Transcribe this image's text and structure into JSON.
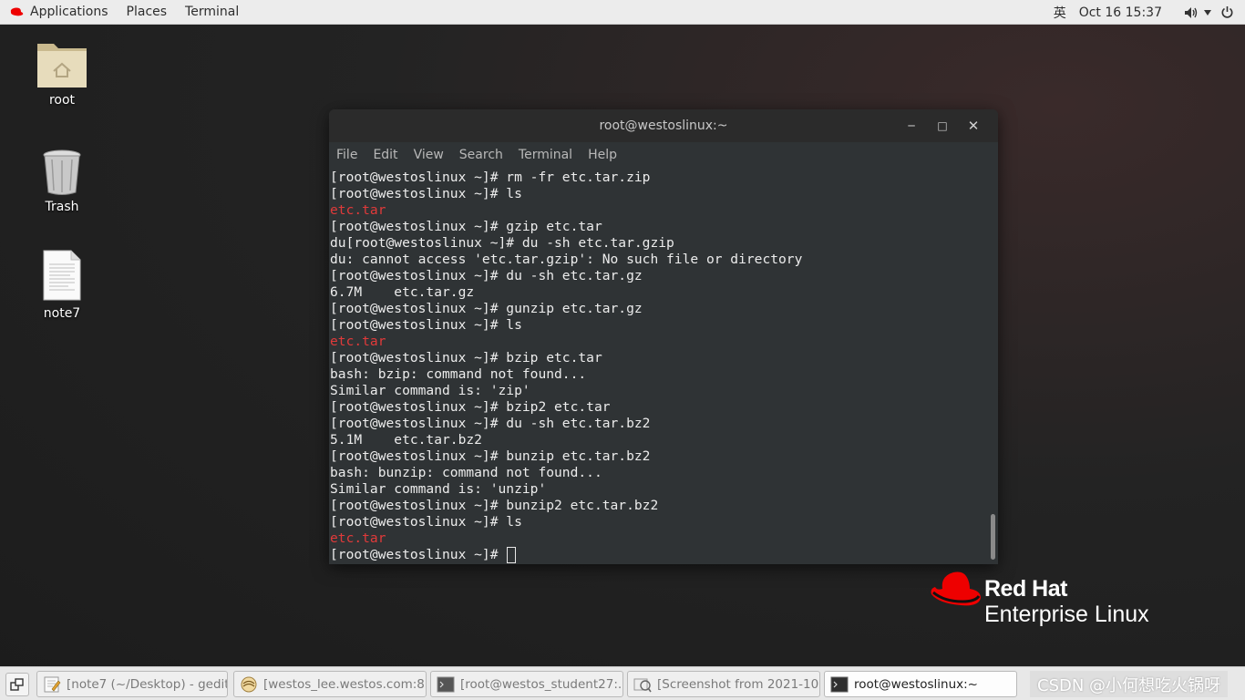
{
  "topbar": {
    "applications": "Applications",
    "places": "Places",
    "terminal": "Terminal",
    "input_method": "英",
    "clock": "Oct 16  15:37"
  },
  "desktop": {
    "icons": [
      {
        "label": "root"
      },
      {
        "label": "Trash"
      },
      {
        "label": "note7"
      }
    ]
  },
  "window": {
    "title": "root@westoslinux:~",
    "menu": [
      "File",
      "Edit",
      "View",
      "Search",
      "Terminal",
      "Help"
    ],
    "lines": [
      {
        "text": "[root@westoslinux ~]# rm -fr etc.tar.zip",
        "red": false
      },
      {
        "text": "[root@westoslinux ~]# ls",
        "red": false
      },
      {
        "text": "etc.tar",
        "red": true
      },
      {
        "text": "[root@westoslinux ~]# gzip etc.tar",
        "red": false
      },
      {
        "text": "du[root@westoslinux ~]# du -sh etc.tar.gzip",
        "red": false
      },
      {
        "text": "du: cannot access 'etc.tar.gzip': No such file or directory",
        "red": false
      },
      {
        "text": "[root@westoslinux ~]# du -sh etc.tar.gz",
        "red": false
      },
      {
        "text": "6.7M    etc.tar.gz",
        "red": false
      },
      {
        "text": "[root@westoslinux ~]# gunzip etc.tar.gz",
        "red": false
      },
      {
        "text": "[root@westoslinux ~]# ls",
        "red": false
      },
      {
        "text": "etc.tar",
        "red": true
      },
      {
        "text": "[root@westoslinux ~]# bzip etc.tar",
        "red": false
      },
      {
        "text": "bash: bzip: command not found...",
        "red": false
      },
      {
        "text": "Similar command is: 'zip'",
        "red": false
      },
      {
        "text": "[root@westoslinux ~]# bzip2 etc.tar",
        "red": false
      },
      {
        "text": "[root@westoslinux ~]# du -sh etc.tar.bz2",
        "red": false
      },
      {
        "text": "5.1M    etc.tar.bz2",
        "red": false
      },
      {
        "text": "[root@westoslinux ~]# bunzip etc.tar.bz2",
        "red": false
      },
      {
        "text": "bash: bunzip: command not found...",
        "red": false
      },
      {
        "text": "Similar command is: 'unzip'",
        "red": false
      },
      {
        "text": "[root@westoslinux ~]# bunzip2 etc.tar.bz2",
        "red": false
      },
      {
        "text": "[root@westoslinux ~]# ls",
        "red": false
      },
      {
        "text": "etc.tar",
        "red": true
      }
    ],
    "prompt": "[root@westoslinux ~]# "
  },
  "logo": {
    "brand": "Red Hat",
    "subtitle": "Enterprise Linux"
  },
  "taskbar": {
    "tasks": [
      {
        "label": "[note7 (~/Desktop) - gedit]"
      },
      {
        "label": "[westos_lee.westos.com:8 ..."
      },
      {
        "label": "[root@westos_student27:..."
      },
      {
        "label": "[Screenshot from 2021-10..."
      },
      {
        "label": "root@westoslinux:~"
      }
    ],
    "watermark": "CSDN @小何想吃火锅呀"
  },
  "colors": {
    "accent_red": "#e03a3a",
    "brand_red": "#ee0000"
  }
}
